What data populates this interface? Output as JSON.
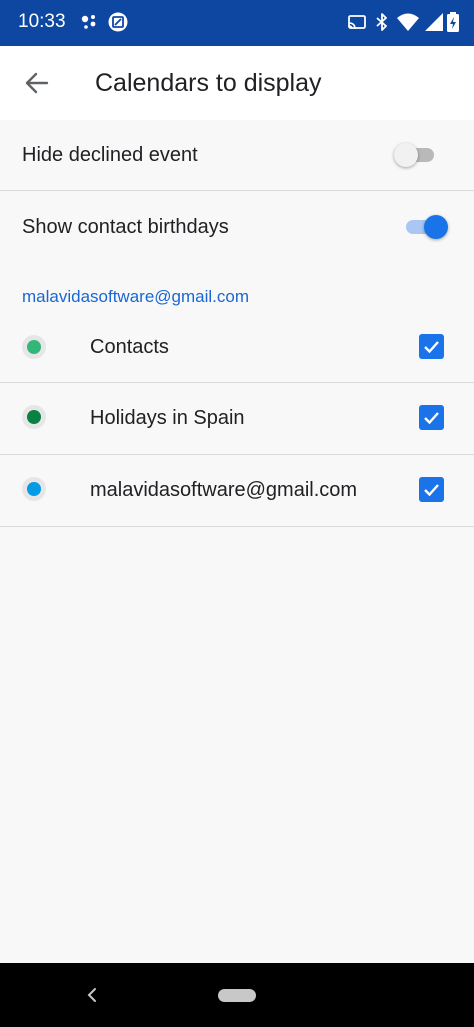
{
  "status_bar": {
    "time": "10:33",
    "left_icons": [
      "assistant-icon",
      "screenshot-icon"
    ],
    "right_icons": [
      "cast-icon",
      "bluetooth-icon",
      "wifi-icon",
      "cellular-icon",
      "battery-icon"
    ],
    "background": "#0e47a1"
  },
  "app_bar": {
    "back_icon": "arrow-back-icon",
    "title": "Calendars to display"
  },
  "settings": [
    {
      "label": "Hide declined event",
      "enabled": false
    },
    {
      "label": "Show contact birthdays",
      "enabled": true
    }
  ],
  "account": {
    "email": "malavidasoftware@gmail.com",
    "calendars": [
      {
        "name": "Contacts",
        "color": "#33b679",
        "checked": true
      },
      {
        "name": "Holidays in Spain",
        "color": "#0b8043",
        "checked": true
      },
      {
        "name": "malavidasoftware@gmail.com",
        "color": "#039be5",
        "checked": true
      }
    ]
  },
  "colors": {
    "accent": "#1a73e8",
    "link": "#1967d2"
  },
  "nav_bar": {
    "back_icon": "nav-back-icon",
    "home_icon": "nav-home-pill-icon"
  }
}
